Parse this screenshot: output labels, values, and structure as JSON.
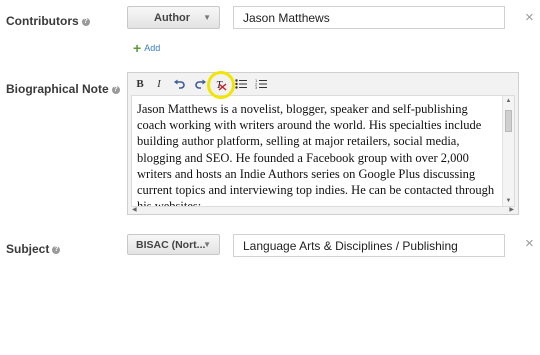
{
  "contributors": {
    "label": "Contributors",
    "role_dropdown": "Author",
    "name_value": "Jason Matthews",
    "remove_symbol": "×",
    "add_label": "Add",
    "add_symbol": "+"
  },
  "bio": {
    "label": "Biographical Note",
    "toolbar": {
      "bold": "B",
      "italic": "I"
    },
    "text": "Jason Matthews is a novelist, blogger, speaker and self-publishing coach working with writers around the world. His specialties include building author platform, selling at major retailers, social media, blogging and SEO. He founded a Facebook group with over 2,000 writers and hosts an Indie Authors series on Google Plus discussing current topics and interviewing top indies. He can be contacted through his websites:"
  },
  "subject": {
    "label": "Subject",
    "scheme_dropdown": "BISAC (Nort...",
    "value": "Language Arts & Disciplines / Publishing",
    "remove_symbol": "×"
  },
  "highlight_color": "#f2e500",
  "accent_link_color": "#3a7ec3"
}
